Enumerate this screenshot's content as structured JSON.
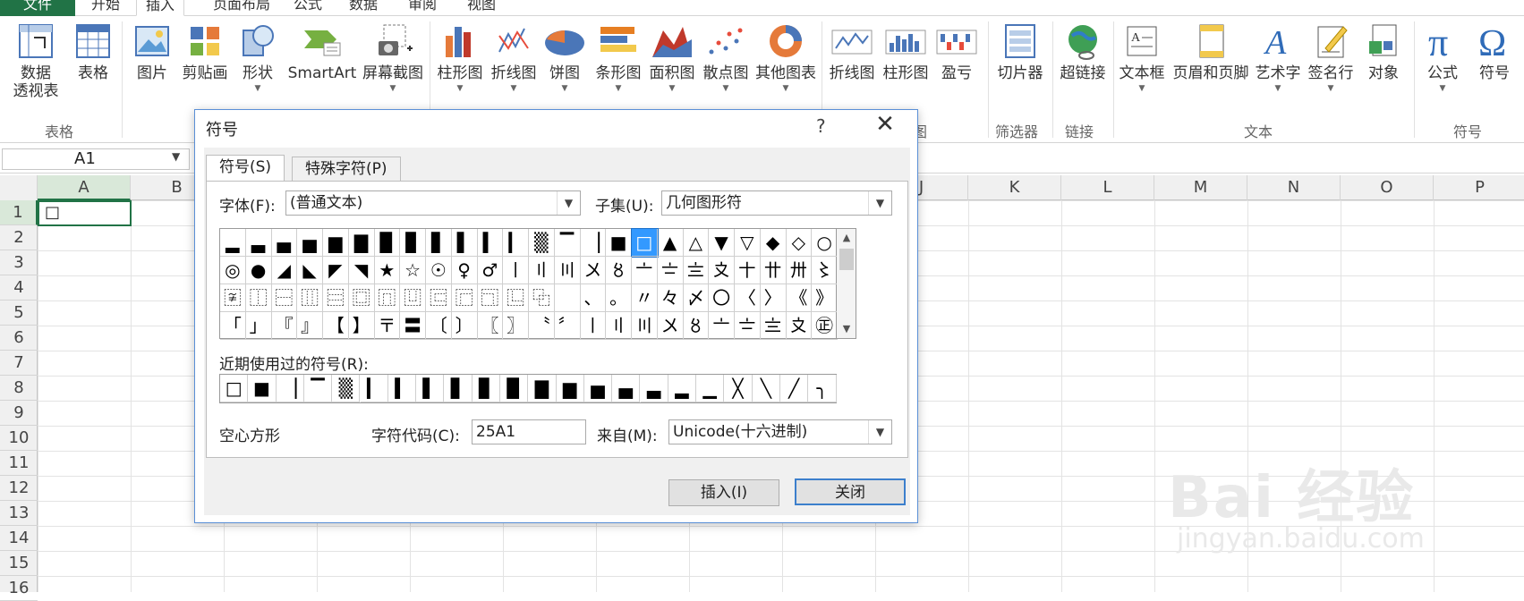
{
  "tabs": {
    "file": "文件",
    "home": "开始",
    "insert": "插入",
    "layout": "页面布局",
    "formulas": "公式",
    "data": "数据",
    "review": "审阅",
    "view": "视图"
  },
  "ribbon": {
    "pivot": "数据\n透视表",
    "pivot_l1": "数据",
    "pivot_l2": "透视表",
    "table": "表格",
    "picture": "图片",
    "clipart": "剪贴画",
    "shapes": "形状",
    "smartart": "SmartArt",
    "screenshot": "屏幕截图",
    "col_chart": "柱形图",
    "line_chart": "折线图",
    "pie_chart": "饼图",
    "bar_chart": "条形图",
    "area_chart": "面积图",
    "scatter_chart": "散点图",
    "other_chart": "其他图表",
    "spark_line": "折线图",
    "spark_col": "柱形图",
    "spark_winloss": "盈亏",
    "slicer": "切片器",
    "hyperlink": "超链接",
    "textbox": "文本框",
    "headerfooter": "页眉和页脚",
    "wordart": "艺术字",
    "signature": "签名行",
    "object": "对象",
    "equation": "公式",
    "symbol": "符号",
    "groups": {
      "tables": "表格",
      "charts_tail": "图",
      "filter": "筛选器",
      "links": "链接",
      "text": "文本",
      "symbols": "符号"
    }
  },
  "namebox": "A1",
  "columns": [
    "A",
    "B",
    "",
    "",
    "",
    "",
    "",
    "",
    "",
    "J",
    "K",
    "L",
    "M",
    "N",
    "O",
    "P"
  ],
  "rows": [
    "1",
    "2",
    "3",
    "4",
    "5",
    "6",
    "7",
    "8",
    "9",
    "10",
    "11",
    "12",
    "13",
    "14",
    "15",
    "16"
  ],
  "cell_a1": "□",
  "watermark": {
    "main": "Bai 经验",
    "sub": "jingyan.baidu.com"
  },
  "dialog": {
    "title": "符号",
    "help": "?",
    "tab_symbols": "符号(S)",
    "tab_special": "特殊字符(P)",
    "font_label": "字体(F):",
    "font_value": "(普通文本)",
    "subset_label": "子集(U):",
    "subset_value": "几何图形符",
    "symbols": [
      [
        "▂",
        "▃",
        "▄",
        "▅",
        "▆",
        "▇",
        "▉",
        "▊",
        "▋",
        "▌",
        "▍",
        "▎",
        "▒",
        "▔",
        "▕",
        "■",
        "□",
        "▲",
        "△",
        "▼",
        "▽",
        "◆",
        "◇",
        "○"
      ],
      [
        "◎",
        "●",
        "◢",
        "◣",
        "◤",
        "◥",
        "★",
        "☆",
        "☉",
        "♀",
        "♂",
        "〡",
        "〢",
        "〣",
        "〤",
        "〥",
        "〦",
        "〧",
        "〨",
        "〩",
        "〸",
        "〹",
        "〺",
        "〻"
      ],
      [
        "〾",
        "⿰",
        "⿱",
        "⿲",
        "⿳",
        "⿴",
        "⿵",
        "⿶",
        "⿷",
        "⿸",
        "⿹",
        "⿺",
        "⿻",
        "　",
        "、",
        "。",
        "〃",
        "々",
        "〆",
        "〇",
        "〈",
        "〉",
        "《",
        "》"
      ],
      [
        "「",
        "」",
        "『",
        "』",
        "【",
        "】",
        "〒",
        "〓",
        "〔",
        "〕",
        "〖",
        "〗",
        "〝",
        "〞",
        "〡",
        "〢",
        "〣",
        "〤",
        "〥",
        "〦",
        "〧",
        "〨",
        "〩",
        "㊣"
      ]
    ],
    "selected_row": 0,
    "selected_col": 16,
    "recent_label": "近期使用过的符号(R):",
    "recent": [
      "□",
      "■",
      "▕",
      "▔",
      "▒",
      "▎",
      "▍",
      "▌",
      "▋",
      "▊",
      "▉",
      "▇",
      "▆",
      "▅",
      "▄",
      "▃",
      "▂",
      "▁",
      "╳",
      "╲",
      "╱",
      "╮"
    ],
    "char_name": "空心方形",
    "code_label": "字符代码(C):",
    "code_value": "25A1",
    "from_label": "来自(M):",
    "from_value": "Unicode(十六进制)",
    "insert_button": "插入(I)",
    "close_button": "关闭"
  }
}
